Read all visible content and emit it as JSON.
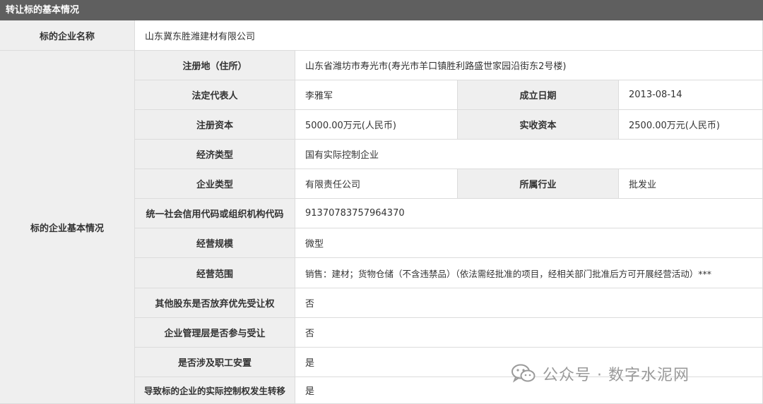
{
  "header": {
    "title": "转让标的基本情况"
  },
  "company_name": {
    "label": "标的企业名称",
    "value": "山东冀东胜潍建材有限公司"
  },
  "basic_info": {
    "label": "标的企业基本情况",
    "registered_address": {
      "label": "注册地（住所）",
      "value": "山东省潍坊市寿光市(寿光市羊口镇胜利路盛世家园沿街东2号楼)"
    },
    "legal_rep": {
      "label": "法定代表人",
      "value": "李雅军"
    },
    "established": {
      "label": "成立日期",
      "value": "2013-08-14"
    },
    "registered_capital": {
      "label": "注册资本",
      "value": "5000.00万元(人民币)"
    },
    "paid_capital": {
      "label": "实收资本",
      "value": "2500.00万元(人民币)"
    },
    "economic_type": {
      "label": "经济类型",
      "value": "国有实际控制企业"
    },
    "company_type": {
      "label": "企业类型",
      "value": "有限责任公司"
    },
    "industry": {
      "label": "所属行业",
      "value": "批发业"
    },
    "credit_code": {
      "label": "统一社会信用代码或组织机构代码",
      "value": "91370783757964370"
    },
    "scale": {
      "label": "经营规模",
      "value": "微型"
    },
    "business_scope": {
      "label": "经营范围",
      "value": "销售：建材；货物仓储（不含违禁品）（依法需经批准的项目，经相关部门批准后方可开展经营活动）***"
    },
    "shareholders_waive": {
      "label": "其他股东是否放弃优先受让权",
      "value": "否"
    },
    "management_participate": {
      "label": "企业管理层是否参与受让",
      "value": "否"
    },
    "staff_placement": {
      "label": "是否涉及职工安置",
      "value": "是"
    },
    "control_transfer": {
      "label": "导致标的企业的实际控制权发生转移",
      "value": "是"
    }
  },
  "watermark": {
    "icon": "wechat-icon",
    "text": "公众号 · 数字水泥网"
  }
}
